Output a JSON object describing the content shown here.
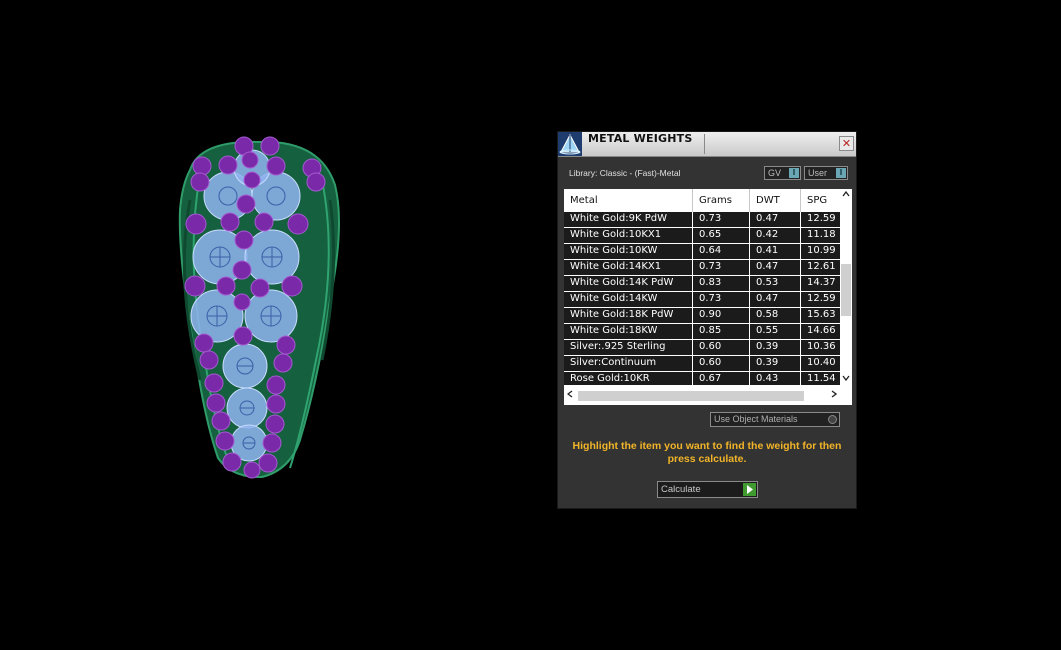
{
  "dialog": {
    "title": "METAL WEIGHTS",
    "close_glyph": "✕",
    "library_label": "Library: Classic - (Fast)-Metal",
    "gv_toggle": {
      "label": "GV",
      "knob": "I"
    },
    "user_toggle": {
      "label": "User",
      "knob": "I"
    },
    "table": {
      "headers": [
        "Metal",
        "Grams",
        "DWT",
        "SPG"
      ],
      "rows": [
        [
          "White Gold:9K PdW",
          "0.73",
          "0.47",
          "12.59"
        ],
        [
          "White Gold:10KX1",
          "0.65",
          "0.42",
          "11.18"
        ],
        [
          "White Gold:10KW",
          "0.64",
          "0.41",
          "10.99"
        ],
        [
          "White Gold:14KX1",
          "0.73",
          "0.47",
          "12.61"
        ],
        [
          "White Gold:14K PdW",
          "0.83",
          "0.53",
          "14.37"
        ],
        [
          "White Gold:14KW",
          "0.73",
          "0.47",
          "12.59"
        ],
        [
          "White Gold:18K PdW",
          "0.90",
          "0.58",
          "15.63"
        ],
        [
          "White Gold:18KW",
          "0.85",
          "0.55",
          "14.66"
        ],
        [
          "Silver:.925 Sterling",
          "0.60",
          "0.39",
          "10.36"
        ],
        [
          "Silver:Continuum",
          "0.60",
          "0.39",
          "10.40"
        ],
        [
          "Rose Gold:10KR",
          "0.67",
          "0.43",
          "11.54"
        ]
      ]
    },
    "use_object_materials": "Use Object Materials",
    "instructions": "Highlight the item you want to find the weight for then press calculate.",
    "calculate_label": "Calculate"
  },
  "colors": {
    "background": "#000000",
    "panel": "#333333",
    "instruction_text": "#f2b428",
    "ring_shank": "#1f7a52",
    "gem_wire": "#8fb4f0",
    "prong": "#7a2aa8",
    "calc_play": "#3f9a2f"
  },
  "icons": {
    "title_logo": "pyramid-logo-icon",
    "close": "close-icon",
    "scroll_up": "arrow-up-icon",
    "scroll_down": "arrow-down-icon",
    "scroll_left": "arrow-left-icon",
    "scroll_right": "arrow-right-icon",
    "calculate": "play-icon"
  }
}
